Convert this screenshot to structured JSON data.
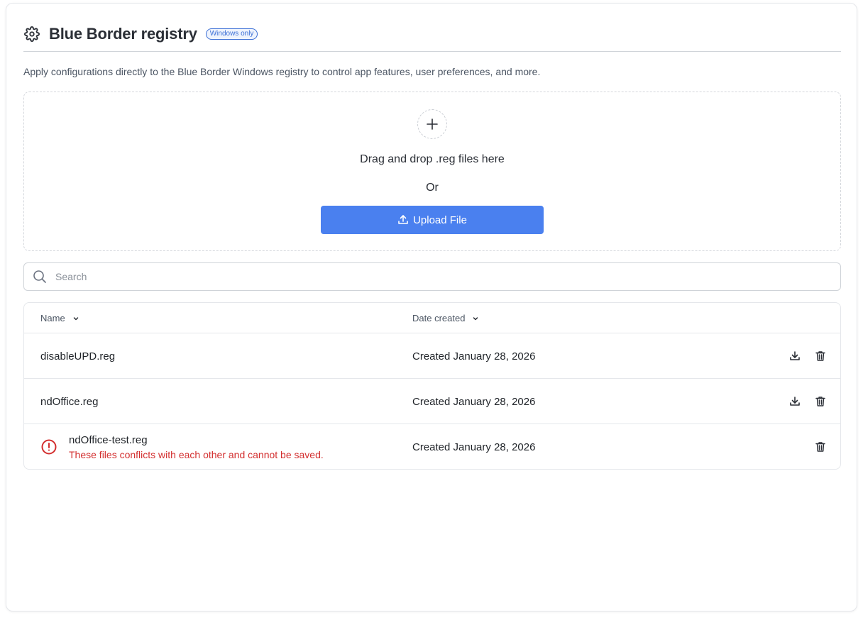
{
  "header": {
    "icon": "gear-icon",
    "title": "Blue Border registry",
    "badge": "Windows only"
  },
  "description": "Apply configurations directly to the Blue Border Windows registry to control app features, user preferences, and more.",
  "dropzone": {
    "icon": "plus-icon",
    "title": "Drag and drop .reg files here",
    "or_text": "Or",
    "upload_label": "Upload File",
    "upload_icon": "upload-icon"
  },
  "search": {
    "icon": "search-icon",
    "placeholder": "Search",
    "value": ""
  },
  "table": {
    "columns": [
      {
        "label": "Name",
        "icon": "chevron-down-icon"
      },
      {
        "label": "Date created",
        "icon": "chevron-down-icon"
      }
    ],
    "rows": [
      {
        "name": "disableUPD.reg",
        "date": "Created January 28, 2026",
        "actions": [
          "download-icon",
          "trash-icon"
        ]
      },
      {
        "name": "ndOffice.reg",
        "date": "Created January 28, 2026",
        "actions": [
          "download-icon",
          "trash-icon"
        ]
      },
      {
        "name": "ndOffice-test.reg",
        "date": "Created January 28, 2026",
        "error": "These files conflicts with each other and cannot be saved.",
        "error_icon": "error-circle-icon",
        "actions": [
          "trash-icon"
        ]
      }
    ]
  },
  "colors": {
    "accent": "#4a80ef",
    "error": "#d32f2f",
    "badge": "#3b6fd6"
  }
}
